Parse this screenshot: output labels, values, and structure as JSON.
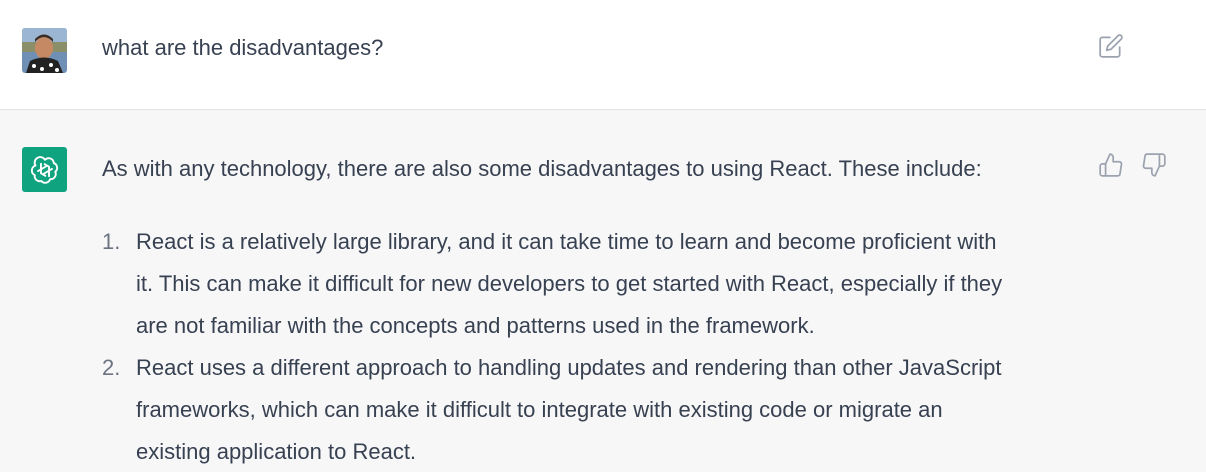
{
  "user_message": {
    "avatar": "user-photo-avatar",
    "text": "what are the disadvantages?",
    "edit_icon": "edit-icon"
  },
  "assistant_message": {
    "avatar": "chatgpt-logo-icon",
    "intro": "As with any technology, there are also some disadvantages to using React. These include:",
    "feedback": {
      "like_icon": "thumbs-up-icon",
      "dislike_icon": "thumbs-down-icon"
    },
    "items": [
      {
        "number": "1.",
        "lines": [
          "React is a relatively large library, and it can take time to learn and become proficient with",
          "it. This can make it difficult for new developers to get started with React, especially if they",
          "are not familiar with the concepts and patterns used in the framework."
        ]
      },
      {
        "number": "2.",
        "lines": [
          "React uses a different approach to handling updates and rendering than other JavaScript",
          "frameworks, which can make it difficult to integrate with existing code or migrate an",
          "existing application to React."
        ]
      }
    ]
  },
  "colors": {
    "user_row_bg": "#ffffff",
    "assistant_row_bg": "#f7f7f8",
    "assistant_avatar_bg": "#10a37f",
    "text": "#374151",
    "icon": "#9ca3af"
  }
}
